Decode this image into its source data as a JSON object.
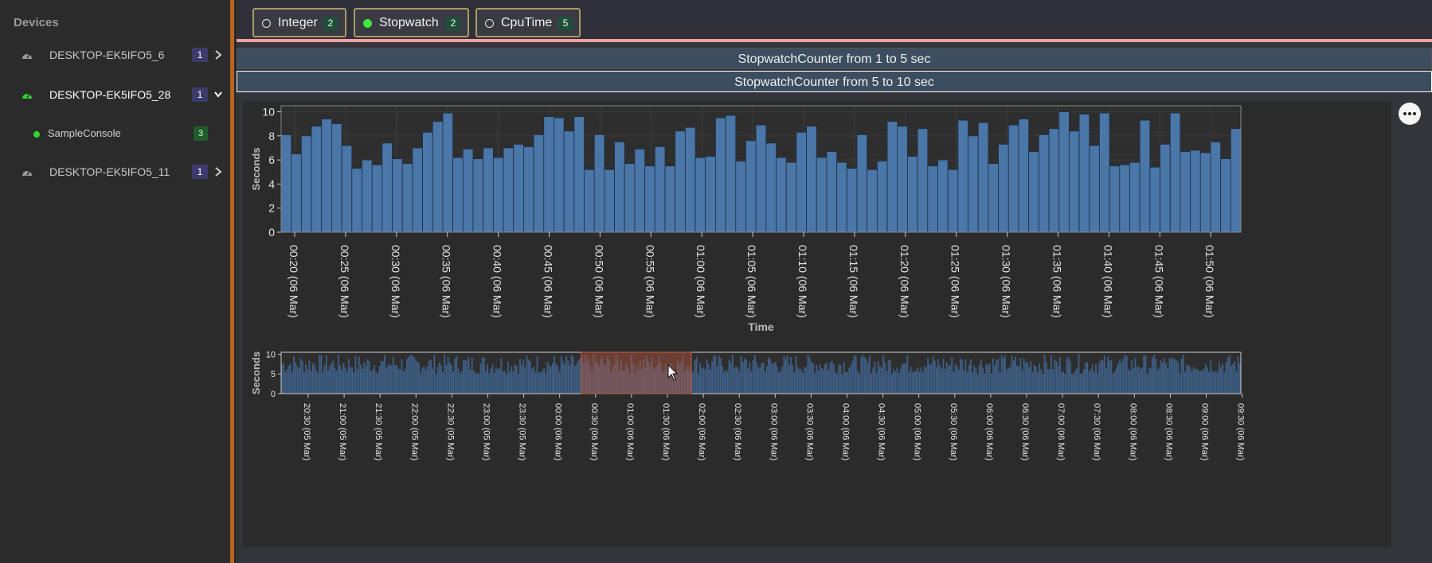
{
  "sidebar": {
    "title": "Devices",
    "devices": [
      {
        "name": "DESKTOP-EK5IFO5_6",
        "count": "1"
      },
      {
        "name": "DESKTOP-EK5IFO5_28",
        "count": "1"
      },
      {
        "name": "DESKTOP-EK5IFO5_11",
        "count": "1"
      }
    ],
    "app": {
      "name": "SampleConsole",
      "count": "3"
    }
  },
  "tabs": [
    {
      "label": "Integer",
      "count": "2"
    },
    {
      "label": "Stopwatch",
      "count": "2"
    },
    {
      "label": "CpuTime",
      "count": "5"
    }
  ],
  "sections": [
    "StopwatchCounter from 1 to 5 sec",
    "StopwatchCounter from 5 to 10 sec"
  ],
  "colors": {
    "bar": "#4a76a8",
    "accent": "#b8661f",
    "online": "#35d435",
    "brush": "#b5553a"
  },
  "chart_data": [
    {
      "type": "bar",
      "xlabel": "Time",
      "ylabel": "Seconds",
      "ylim": [
        0,
        10.5
      ],
      "yticks": [
        0,
        2,
        4,
        6,
        8,
        10
      ],
      "grid": true,
      "xticks": [
        "00:20",
        "00:25",
        "00:30",
        "00:35",
        "00:40",
        "00:45",
        "00:50",
        "00:55",
        "01:00",
        "01:05",
        "01:10",
        "01:15",
        "01:20",
        "01:25",
        "01:30",
        "01:35",
        "01:40",
        "01:45",
        "01:50"
      ],
      "xtick_date": "(06 Mar)",
      "values": [
        8.1,
        6.5,
        8.0,
        8.8,
        9.4,
        9.0,
        7.2,
        5.3,
        6.0,
        5.6,
        7.4,
        6.1,
        5.7,
        7.0,
        8.3,
        9.2,
        9.9,
        6.2,
        6.9,
        6.1,
        7.0,
        6.2,
        7.0,
        7.3,
        7.1,
        8.1,
        9.6,
        9.5,
        8.4,
        9.6,
        5.2,
        8.1,
        5.2,
        7.5,
        5.7,
        6.9,
        5.5,
        7.1,
        5.5,
        8.4,
        8.7,
        6.2,
        6.3,
        9.5,
        9.7,
        5.9,
        7.6,
        8.9,
        7.4,
        6.2,
        5.8,
        8.3,
        8.8,
        6.2,
        6.7,
        5.8,
        5.3,
        8.1,
        5.2,
        5.9,
        9.2,
        8.8,
        6.3,
        8.6,
        5.5,
        6.0,
        5.2,
        9.3,
        8.0,
        9.1,
        5.7,
        7.3,
        8.9,
        9.4,
        6.7,
        8.1,
        8.6,
        10.0,
        8.4,
        9.8,
        7.2,
        9.9,
        5.5,
        5.6,
        5.8,
        9.3,
        5.4,
        7.3,
        9.9,
        6.7,
        6.8,
        6.6,
        7.5,
        6.1,
        8.6
      ]
    },
    {
      "type": "bar",
      "ylabel": "Seconds",
      "ylim": [
        0,
        10.5
      ],
      "yticks": [
        0,
        5,
        10
      ],
      "xticks": [
        "20:30 (05 Mar)",
        "21:00 (05 Mar)",
        "21:30 (05 Mar)",
        "22:00 (05 Mar)",
        "22:30 (05 Mar)",
        "23:00 (05 Mar)",
        "23:30 (05 Mar)",
        "00:00 (06 Mar)",
        "00:30 (06 Mar)",
        "01:00 (06 Mar)",
        "01:30 (06 Mar)",
        "02:00 (06 Mar)",
        "02:30 (06 Mar)",
        "03:00 (06 Mar)",
        "03:30 (06 Mar)",
        "04:00 (06 Mar)",
        "04:30 (06 Mar)",
        "05:00 (06 Mar)",
        "05:30 (06 Mar)",
        "06:00 (06 Mar)",
        "06:30 (06 Mar)",
        "07:00 (06 Mar)",
        "07:30 (06 Mar)",
        "08:00 (06 Mar)",
        "08:30 (06 Mar)",
        "09:00 (06 Mar)",
        "09:30 (06 Mar)"
      ],
      "selection": [
        "00:18",
        "01:50"
      ]
    }
  ]
}
